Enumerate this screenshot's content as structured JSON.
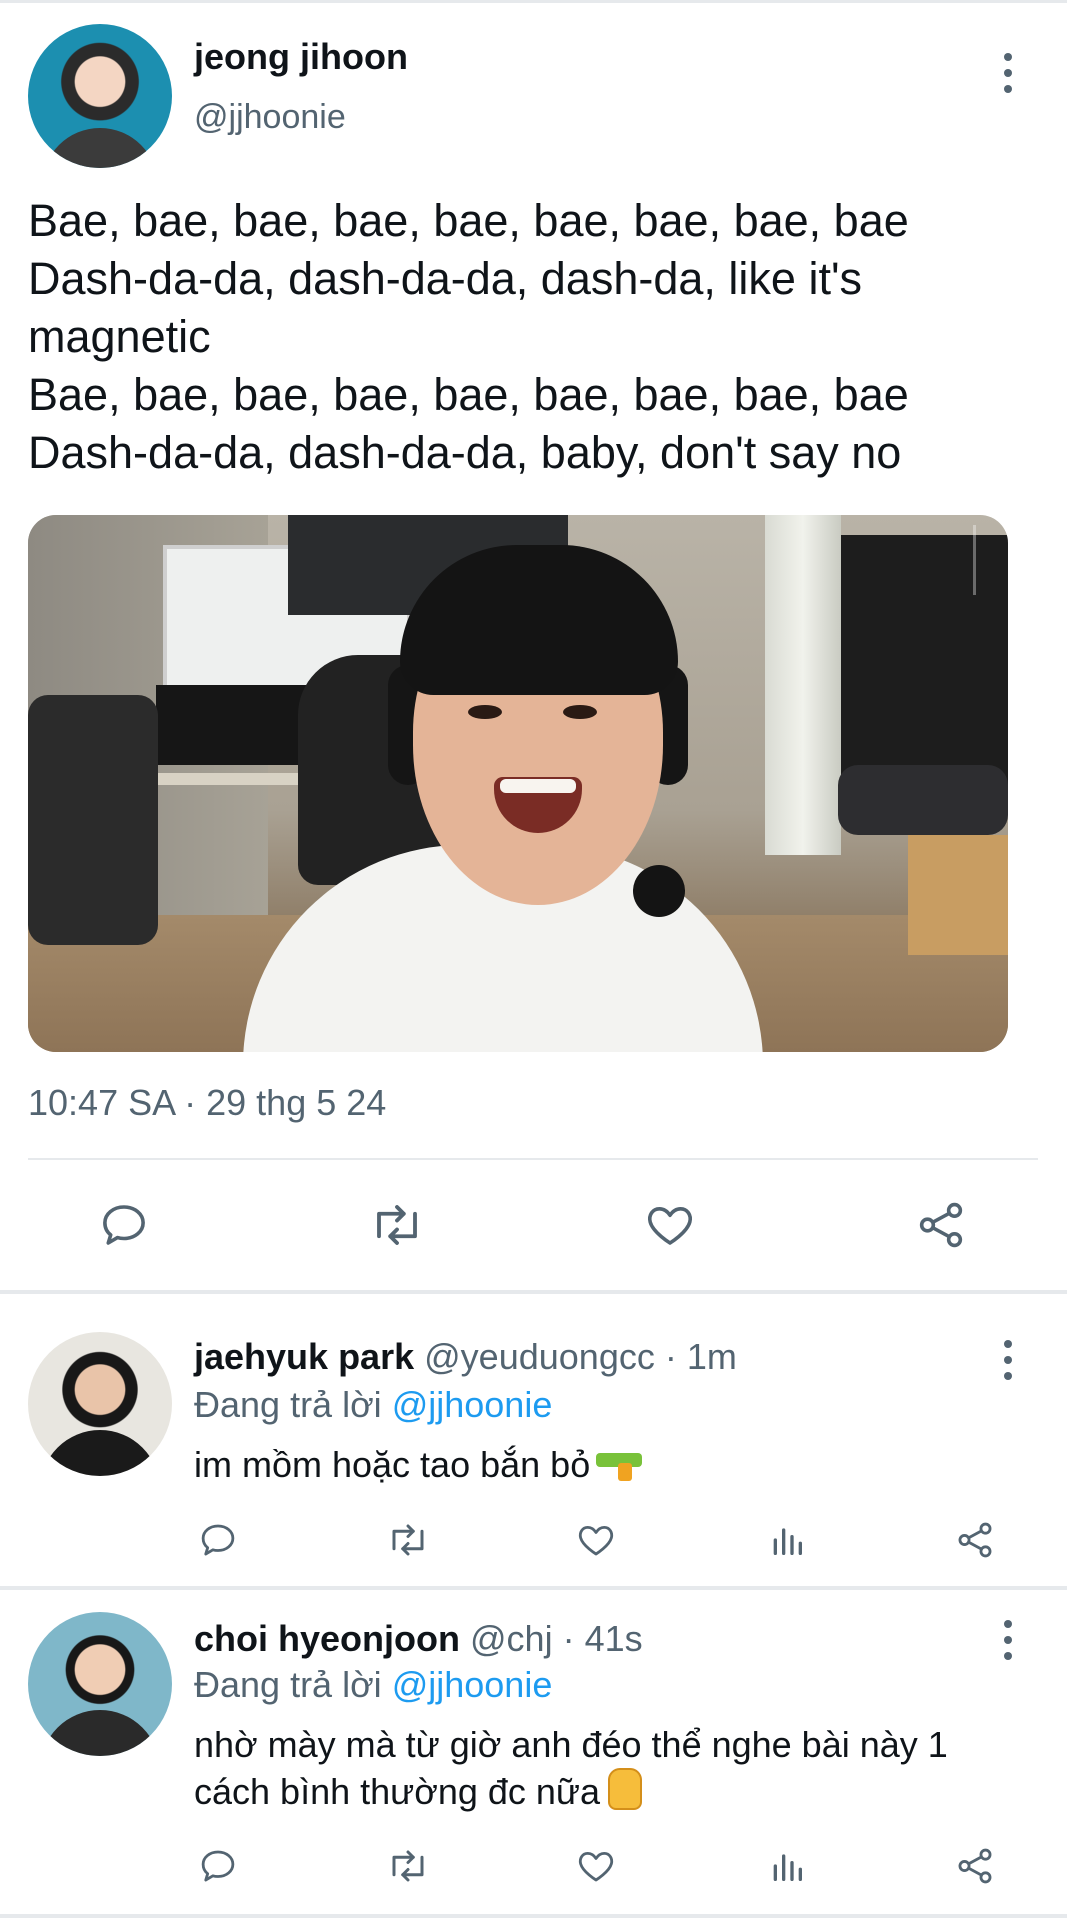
{
  "tweet": {
    "author": {
      "name": "jeong jihoon",
      "handle": "@jjhoonie",
      "avatar_icon": "profile-photo"
    },
    "text_lines": [
      "Bae, bae, bae, bae, bae, bae, bae, bae, bae",
      "Dash-da-da, dash-da-da, dash-da, like it's",
      "magnetic",
      "Bae, bae, bae, bae, bae, bae, bae, bae, bae",
      "Dash-da-da, dash-da-da, baby, don't say no"
    ],
    "media_icon": "video-thumbnail",
    "timestamp": "10:47 SA · 29 thg 5 24",
    "actions": [
      "reply-icon",
      "retweet-icon",
      "like-icon",
      "share-icon"
    ]
  },
  "replies": [
    {
      "name": "jaehyuk park",
      "handle": "@yeuduongcc",
      "time": "1m",
      "replying_prefix": "Đang trả lời",
      "replying_to": "@jjhoonie",
      "text_lines": [
        "im mồm hoặc tao bắn bỏ"
      ],
      "emoji": "water-pistol-emoji",
      "actions": [
        "reply-icon",
        "retweet-icon",
        "like-icon",
        "views-icon",
        "share-icon"
      ]
    },
    {
      "name": "choi hyeonjoon",
      "handle": "@chj",
      "time": "41s",
      "replying_prefix": "Đang trả lời",
      "replying_to": "@jjhoonie",
      "text_lines": [
        "nhờ mày mà từ giờ anh đéo thể nghe bài này 1",
        "cách bình thường đc nữa"
      ],
      "emoji": "thumbs-up-emoji",
      "actions": [
        "reply-icon",
        "retweet-icon",
        "like-icon",
        "views-icon",
        "share-icon"
      ]
    }
  ],
  "colors": {
    "text": "#0f1419",
    "secondary": "#536471",
    "link": "#1d9bf0",
    "divider": "#e6e9ec"
  }
}
